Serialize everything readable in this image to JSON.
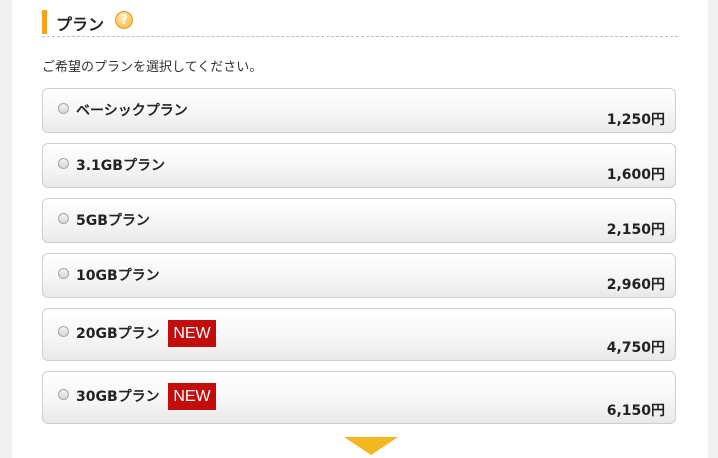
{
  "section": {
    "title": "プラン",
    "help_icon": "?",
    "instruction": "ご希望のプランを選択してください。"
  },
  "plans": [
    {
      "name": "ベーシックプラン",
      "price": "1,250円",
      "badge": ""
    },
    {
      "name": "3.1GBプラン",
      "price": "1,600円",
      "badge": ""
    },
    {
      "name": "5GBプラン",
      "price": "2,150円",
      "badge": ""
    },
    {
      "name": "10GBプラン",
      "price": "2,960円",
      "badge": ""
    },
    {
      "name": "20GBプラン",
      "price": "4,750円",
      "badge": "NEW"
    },
    {
      "name": "30GBプラン",
      "price": "6,150円",
      "badge": "NEW"
    }
  ],
  "colors": {
    "accent": "#f2a31b",
    "badge_bg": "#c30d0d",
    "arrow": "#f3b81e"
  },
  "icons": {
    "help": "question-circle-icon",
    "next": "chevron-down-icon"
  }
}
